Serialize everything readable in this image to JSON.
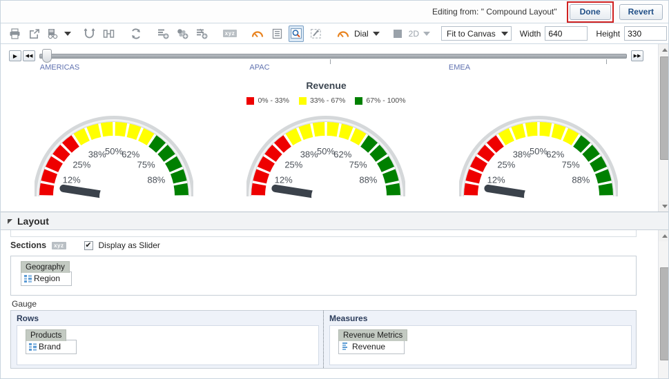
{
  "topbar": {
    "editing_from": "Editing from: \" Compound Layout\"",
    "done_label": "Done",
    "revert_label": "Revert",
    "done_highlight_color": "#cf2020"
  },
  "toolbar": {
    "items": [
      {
        "name": "print-icon",
        "title": "Print"
      },
      {
        "name": "export-icon",
        "title": "Export"
      },
      {
        "name": "preview-icon",
        "title": "Preview"
      },
      {
        "name": "preview-dropdown-caret",
        "title": "Preview options"
      },
      {
        "name": "undo-icon",
        "title": "Undo"
      },
      {
        "name": "redo-icon",
        "title": "Redo"
      },
      {
        "name": "refresh-icon",
        "title": "Refresh"
      },
      {
        "name": "add-view-icon",
        "title": "Add View"
      },
      {
        "name": "add-group-icon",
        "title": "Add Group"
      },
      {
        "name": "add-calc-icon",
        "title": "Add Calculated Item"
      },
      {
        "name": "xyz-icon",
        "title": "Edit Formula"
      },
      {
        "name": "gauge-properties-icon",
        "title": "Gauge Properties"
      },
      {
        "name": "show-legend-icon",
        "title": "Show Legend"
      },
      {
        "name": "zoom-icon",
        "title": "Zoom"
      },
      {
        "name": "format-icon",
        "title": "Format"
      }
    ],
    "gauge_type_label": "Dial",
    "dimension_label": "2D",
    "canvas_mode": "Fit to Canvas",
    "width_label": "Width",
    "width_value": "640",
    "height_label": "Height",
    "height_value": "330"
  },
  "slider": {
    "play_icon": "▶",
    "rewind_icon": "◀◀",
    "forward_icon": "▶▶",
    "labels": [
      "AMERICAS",
      "APAC",
      "EMEA"
    ],
    "positions": [
      1,
      50,
      97
    ],
    "thumb_position": 1
  },
  "chart_data": {
    "type": "gauge",
    "title": "Revenue",
    "legend_position": "top",
    "legend": [
      {
        "label": "0% - 33%",
        "color": "#ee0000"
      },
      {
        "label": "33% - 67%",
        "color": "#ffff00"
      },
      {
        "label": "67% - 100%",
        "color": "#008000"
      }
    ],
    "tick_labels": [
      "12%",
      "25%",
      "38%",
      "50%",
      "62%",
      "75%",
      "88%"
    ],
    "axis_min": 0,
    "axis_max": 100,
    "ranges": [
      {
        "from": 0,
        "to": 33,
        "color": "#ee0000"
      },
      {
        "from": 33,
        "to": 67,
        "color": "#ffff00"
      },
      {
        "from": 67,
        "to": 100,
        "color": "#008000"
      }
    ],
    "gauges": [
      {
        "name": "gauge-1",
        "value": 5
      },
      {
        "name": "gauge-2",
        "value": 5
      },
      {
        "name": "gauge-3",
        "value": 5
      }
    ]
  },
  "layout": {
    "header_title": "Layout",
    "sections_label": "Sections",
    "sections_badge": "xyz",
    "display_as_slider_label": "Display as Slider",
    "display_as_slider_checked": true,
    "sections_pill": {
      "header": "Geography",
      "item": "Region"
    },
    "gauge_label": "Gauge",
    "rows_title": "Rows",
    "rows_pill": {
      "header": "Products",
      "item": "Brand"
    },
    "measures_title": "Measures",
    "measures_pill": {
      "header": "Revenue Metrics",
      "item": "Revenue"
    }
  }
}
